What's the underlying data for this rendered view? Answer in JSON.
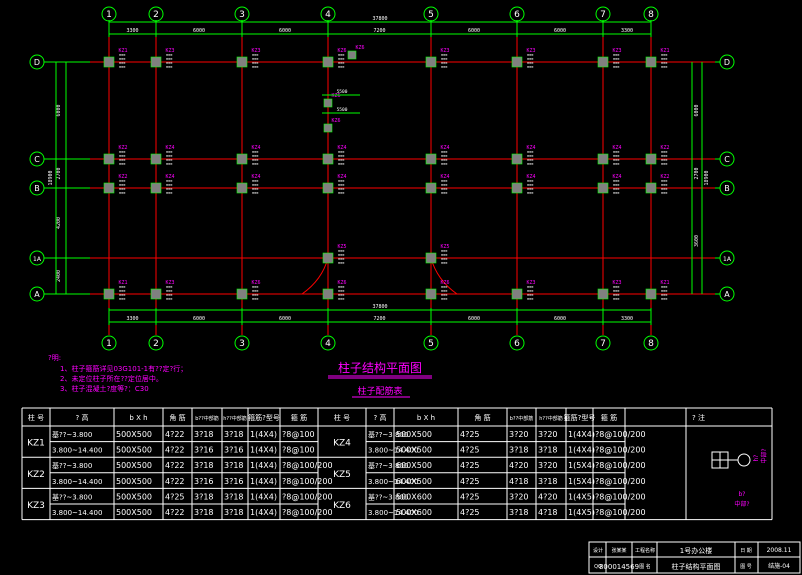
{
  "grid": {
    "columns": [
      "1",
      "2",
      "3",
      "4",
      "5",
      "6",
      "7",
      "8"
    ],
    "rows": [
      "D",
      "C",
      "B",
      "1A",
      "A"
    ],
    "top_dims": [
      "3300",
      "6000",
      "6000",
      "7200",
      "6000",
      "6000",
      "3300"
    ],
    "bottom_dims": [
      "3300",
      "6000",
      "6000",
      "7200",
      "6000",
      "6000",
      "3300"
    ],
    "total_dim": "37800",
    "left_dims": [
      "6000",
      "2700",
      "4200",
      "2400"
    ],
    "left_total": "18900",
    "right_dims": [
      "6000",
      "2700",
      "3600"
    ],
    "right_total": "18900"
  },
  "column_marks": [
    {
      "r": 0,
      "c": 0,
      "label": "KZ1"
    },
    {
      "r": 0,
      "c": 1,
      "label": "KZ3"
    },
    {
      "r": 0,
      "c": 2,
      "label": "KZ3"
    },
    {
      "r": 0,
      "c": 3,
      "label": "KZ6"
    },
    {
      "r": 0,
      "c": 4,
      "label": "KZ3"
    },
    {
      "r": 0,
      "c": 5,
      "label": "KZ3"
    },
    {
      "r": 0,
      "c": 6,
      "label": "KZ3"
    },
    {
      "r": 0,
      "c": 7,
      "label": "KZ1"
    },
    {
      "r": 1,
      "c": 0,
      "label": "KZ2"
    },
    {
      "r": 1,
      "c": 1,
      "label": "KZ4"
    },
    {
      "r": 1,
      "c": 2,
      "label": "KZ4"
    },
    {
      "r": 1,
      "c": 3,
      "label": "KZ4"
    },
    {
      "r": 1,
      "c": 4,
      "label": "KZ4"
    },
    {
      "r": 1,
      "c": 5,
      "label": "KZ4"
    },
    {
      "r": 1,
      "c": 6,
      "label": "KZ4"
    },
    {
      "r": 1,
      "c": 7,
      "label": "KZ2"
    },
    {
      "r": 2,
      "c": 0,
      "label": "KZ2"
    },
    {
      "r": 2,
      "c": 1,
      "label": "KZ4"
    },
    {
      "r": 2,
      "c": 2,
      "label": "KZ4"
    },
    {
      "r": 2,
      "c": 3,
      "label": "KZ4"
    },
    {
      "r": 2,
      "c": 4,
      "label": "KZ4"
    },
    {
      "r": 2,
      "c": 5,
      "label": "KZ4"
    },
    {
      "r": 2,
      "c": 6,
      "label": "KZ4"
    },
    {
      "r": 2,
      "c": 7,
      "label": "KZ2"
    },
    {
      "r": 3,
      "c": 3,
      "label": "KZ5"
    },
    {
      "r": 3,
      "c": 4,
      "label": "KZ5"
    },
    {
      "r": 4,
      "c": 0,
      "label": "KZ1"
    },
    {
      "r": 4,
      "c": 1,
      "label": "KZ3"
    },
    {
      "r": 4,
      "c": 2,
      "label": "KZ6"
    },
    {
      "r": 4,
      "c": 3,
      "label": "KZ6"
    },
    {
      "r": 4,
      "c": 4,
      "label": "KZ6"
    },
    {
      "r": 4,
      "c": 5,
      "label": "KZ3"
    },
    {
      "r": 4,
      "c": 6,
      "label": "KZ3"
    },
    {
      "r": 4,
      "c": 7,
      "label": "KZ1"
    }
  ],
  "extra_marks": [
    "KZ6",
    "KZ6",
    "KZ6"
  ],
  "extra_dims": [
    "5500",
    "5500"
  ],
  "drawing_title": "柱子结构平面图",
  "table_title": "柱子配筋表",
  "notes": {
    "heading": "?明:",
    "items": [
      "1、柱子箍筋详见03G101-1有??定?行；",
      "2、未定位柱子所在??定位居中。",
      "3、柱子混凝土?度等?：C30"
    ]
  },
  "table": {
    "headers": [
      "柱 号",
      "? 高",
      "b X h",
      "角 筋",
      "b??中部筋",
      "h??中部筋",
      "箍筋?型号",
      "箍 筋",
      "? 注"
    ],
    "left": [
      {
        "id": "KZ1",
        "rows": [
          [
            "基??~3.800",
            "500X500",
            "4?22",
            "3?18",
            "3?18",
            "1(4X4)",
            "?8@100"
          ],
          [
            "3.800~14.400",
            "500X500",
            "4?22",
            "3?16",
            "3?16",
            "1(4X4)",
            "?8@100"
          ]
        ]
      },
      {
        "id": "KZ2",
        "rows": [
          [
            "基??~3.800",
            "500X500",
            "4?22",
            "3?18",
            "3?18",
            "1(4X4)",
            "?8@100/200"
          ],
          [
            "3.800~14.400",
            "500X500",
            "4?22",
            "3?16",
            "3?16",
            "1(4X4)",
            "?8@100/200"
          ]
        ]
      },
      {
        "id": "KZ3",
        "rows": [
          [
            "基??~3.800",
            "500X500",
            "4?25",
            "3?18",
            "3?18",
            "1(4X4)",
            "?8@100/200"
          ],
          [
            "3.800~14.400",
            "500X500",
            "4?22",
            "3?18",
            "3?18",
            "1(4X4)",
            "?8@100/200"
          ]
        ]
      }
    ],
    "right": [
      {
        "id": "KZ4",
        "rows": [
          [
            "基??~3.800",
            "500X500",
            "4?25",
            "3?20",
            "3?20",
            "1(4X4)",
            "?8@100/200"
          ],
          [
            "3.800~14.400",
            "500X500",
            "4?25",
            "3?18",
            "3?18",
            "1(4X4)",
            "?8@100/200"
          ]
        ]
      },
      {
        "id": "KZ5",
        "rows": [
          [
            "基??~3.800",
            "600X500",
            "4?25",
            "4?20",
            "3?20",
            "1(5X4)",
            "?8@100/200"
          ],
          [
            "3.800~14.400",
            "600X500",
            "4?25",
            "4?18",
            "3?18",
            "1(5X4)",
            "?8@100/200"
          ]
        ]
      },
      {
        "id": "KZ6",
        "rows": [
          [
            "基??~3.800",
            "500X600",
            "4?25",
            "3?20",
            "4?20",
            "1(4X5)",
            "?8@100/200"
          ],
          [
            "3.800~14.400",
            "500X600",
            "4?25",
            "3?18",
            "4?18",
            "1(4X5)",
            "?8@100/200"
          ]
        ]
      }
    ],
    "legend": {
      "h_label": "h?",
      "b_label": "b?",
      "sub": "中部?"
    }
  },
  "title_block": {
    "c1": "设计",
    "c2": "张某某",
    "c3": "工程名称",
    "project": "1号办公楼",
    "date_label": "日 期",
    "date": "2008.11",
    "id": "800014569",
    "c4": "图 名",
    "drawing": "柱子结构平面图",
    "sheet_label": "图 号",
    "sheet": "结施-04"
  },
  "colors": {
    "grid_line": "#ff0000",
    "dim_line": "#00ff00",
    "text": "#ffffff",
    "label": "#ff00ff",
    "accent": "#00ffff",
    "column": "#808080"
  }
}
